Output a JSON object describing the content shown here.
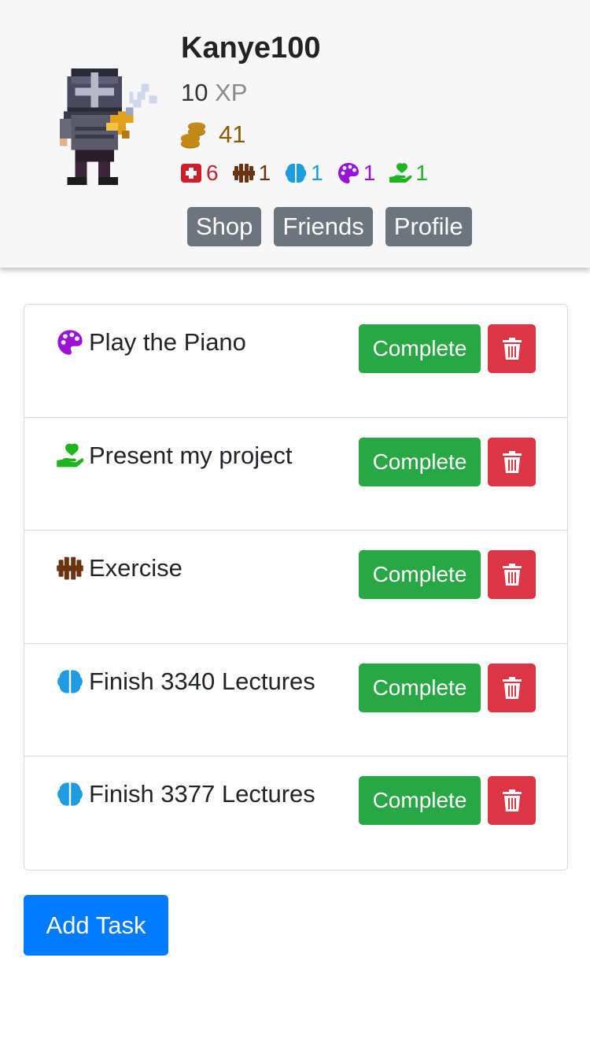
{
  "profile": {
    "username": "Kanye100",
    "xp_value": "10",
    "xp_unit": "XP",
    "coins": "41"
  },
  "stats": [
    {
      "icon": "health-icon",
      "value": "6",
      "color": "#cc1d2b"
    },
    {
      "icon": "dumbbell-icon",
      "value": "1",
      "color": "#6b3410"
    },
    {
      "icon": "brain-icon",
      "value": "1",
      "color": "#1f9be0"
    },
    {
      "icon": "palette-icon",
      "value": "1",
      "color": "#9a12d6"
    },
    {
      "icon": "hand-heart-icon",
      "value": "1",
      "color": "#1fb51f"
    }
  ],
  "nav": {
    "shop": "Shop",
    "friends": "Friends",
    "profile": "Profile"
  },
  "tasks": [
    {
      "icon": "palette-icon",
      "label": "Play the Piano",
      "complete": "Complete"
    },
    {
      "icon": "hand-heart-icon",
      "label": "Present my project",
      "complete": "Complete"
    },
    {
      "icon": "dumbbell-icon",
      "label": "Exercise",
      "complete": "Complete"
    },
    {
      "icon": "brain-icon",
      "label": "Finish 3340 Lectures",
      "complete": "Complete"
    },
    {
      "icon": "brain-icon",
      "label": "Finish 3377 Lectures",
      "complete": "Complete"
    }
  ],
  "add_task_label": "Add Task",
  "colors": {
    "complete": "#28a745",
    "delete": "#dc3545",
    "primary": "#007bff",
    "secondary": "#6c757d"
  }
}
